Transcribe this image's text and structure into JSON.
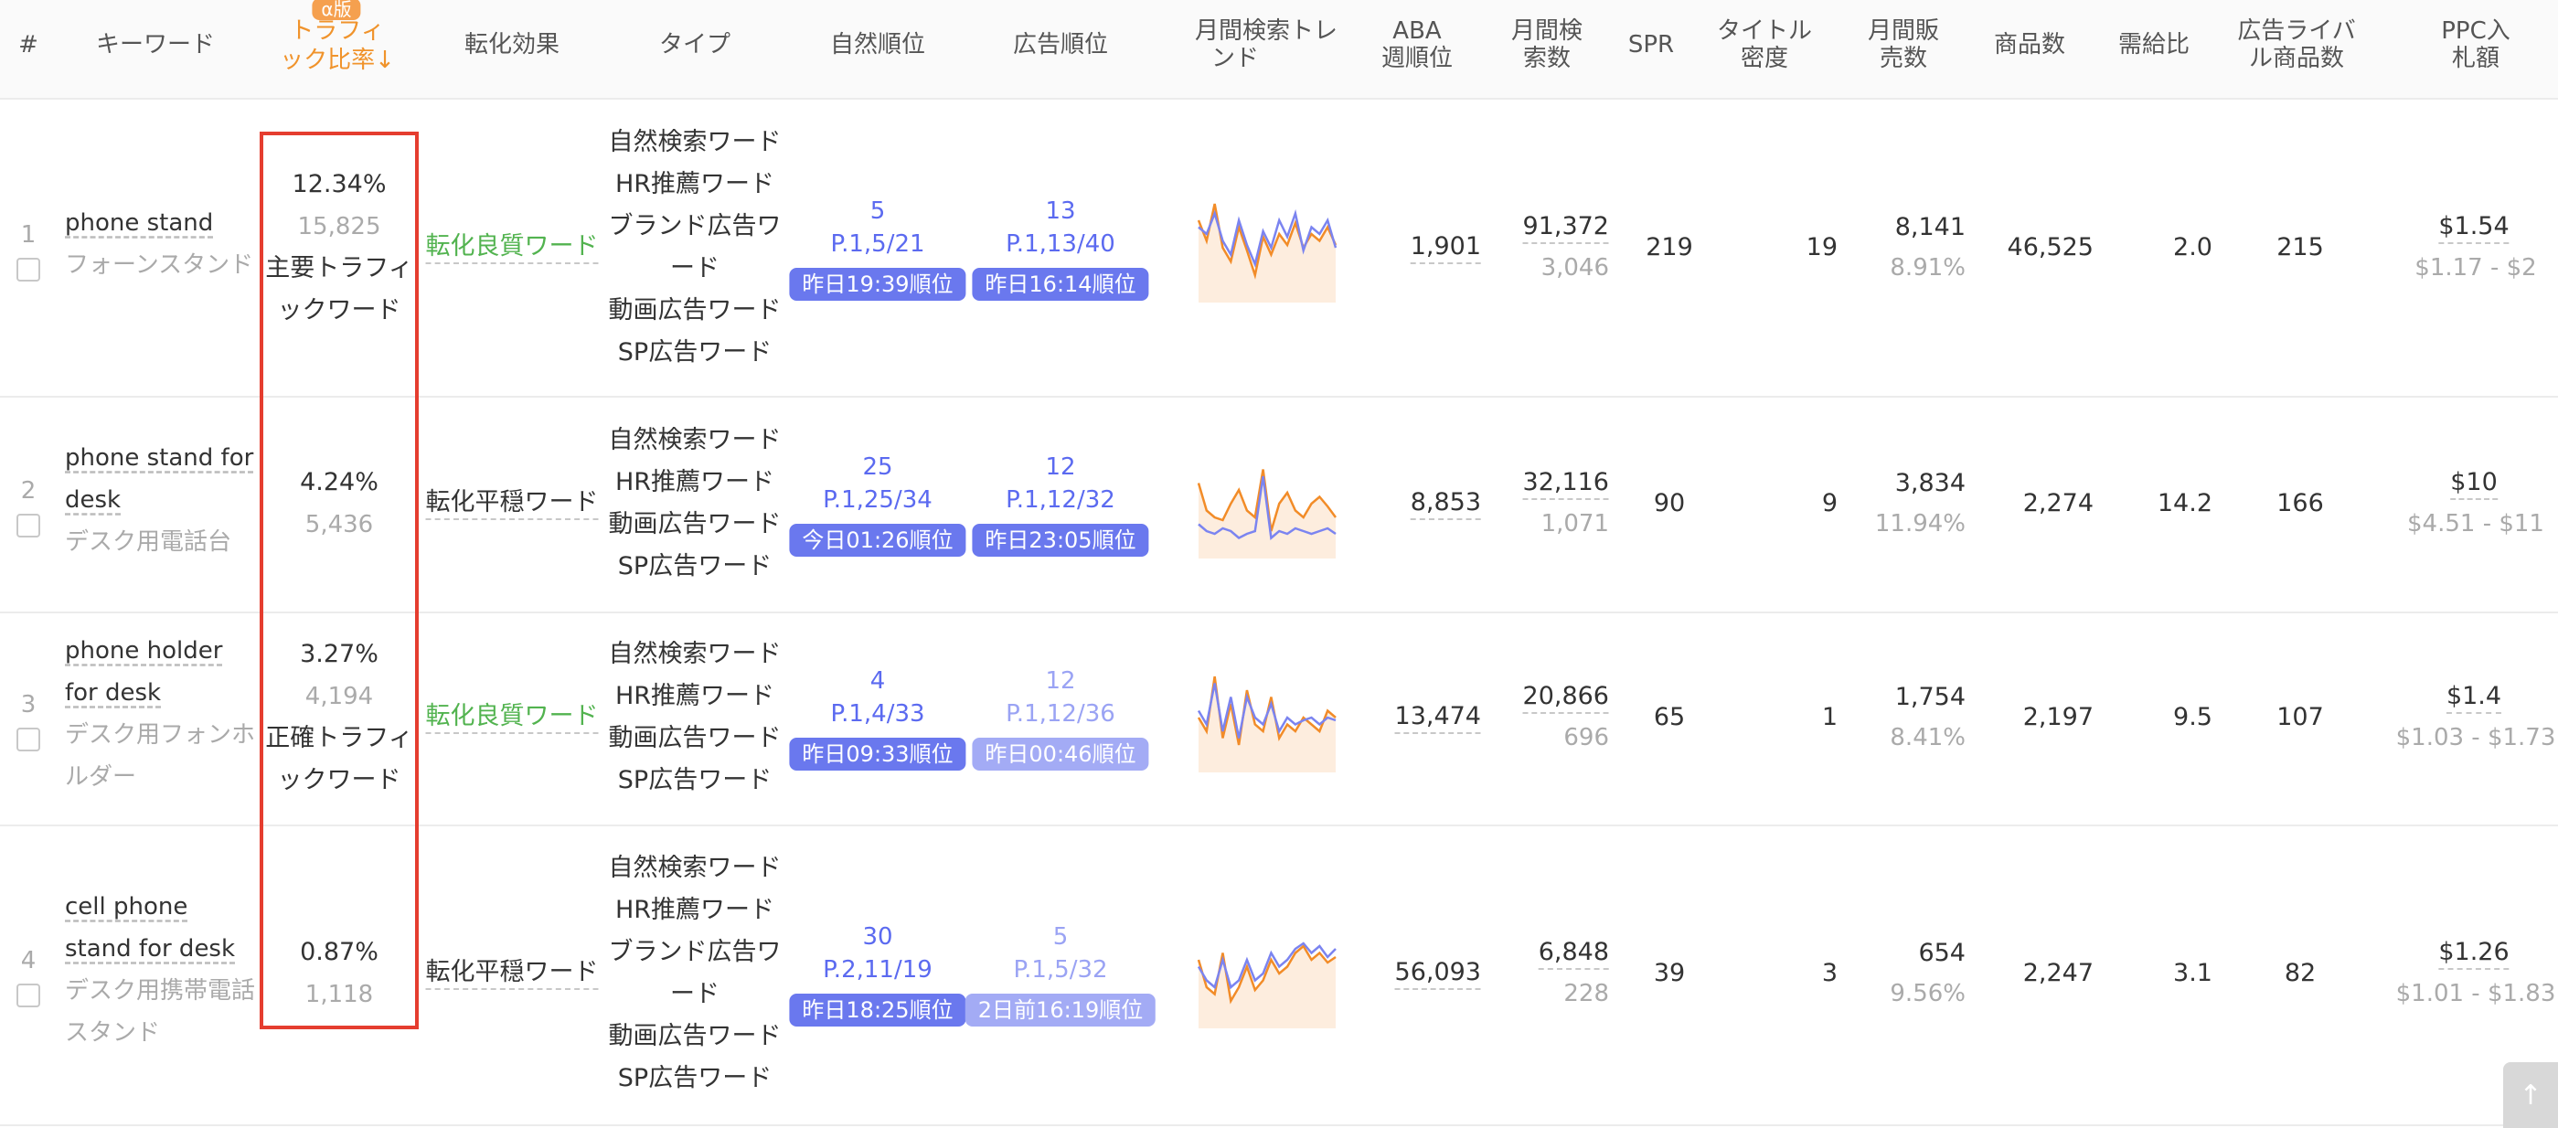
{
  "header": {
    "num": "#",
    "keyword": "キーワード",
    "alpha_badge": "α版",
    "traffic1": "トラフィ",
    "traffic2": "ック比率↓",
    "conversion": "転化効果",
    "type": "タイプ",
    "natural_rank": "自然順位",
    "ad_rank": "広告順位",
    "trend1": "月間検索トレ",
    "trend2": "ンド",
    "aba1": "ABA",
    "aba2": "週順位",
    "monthly1": "月間検",
    "monthly2": "索数",
    "spr": "SPR",
    "title_density1": "タイトル",
    "title_density2": "密度",
    "sales1": "月間販",
    "sales2": "売数",
    "products": "商品数",
    "supply": "需給比",
    "ad_rival1": "広告ライバ",
    "ad_rival2": "ル商品数",
    "ppc1": "PPC入",
    "ppc2": "札額"
  },
  "rows": [
    {
      "index": "1",
      "keyword_lines": [
        "phone stand"
      ],
      "translation_lines": [
        "フォーンスタンド"
      ],
      "traffic_ratio": "12.34%",
      "traffic_count": "15,825",
      "traffic_tag_lines": [
        "主要トラフィ",
        "ックワード"
      ],
      "conversion": "転化良質ワード",
      "types": [
        "自然検索ワード",
        "HR推薦ワード",
        "ブランド広告ワ",
        "ード",
        "動画広告ワード",
        "SP広告ワード"
      ],
      "natural_rank": "5",
      "natural_page": "P.1,5/21",
      "natural_time": "昨日19:39順位",
      "ad_rank": "13",
      "ad_page": "P.1,13/40",
      "ad_time": "昨日16:14順位",
      "aba": "1,901",
      "monthly_search": "91,372",
      "monthly_sub": "3,046",
      "spr": "219",
      "title_density": "19",
      "monthly_sales": "8,141",
      "sales_pct": "8.91%",
      "products": "46,525",
      "supply_ratio": "2.0",
      "ad_rivals": "215",
      "ppc": "$1.54",
      "ppc_range": "$1.17 - $2",
      "trend_orange": [
        60,
        45,
        72,
        40,
        30,
        55,
        38,
        20,
        48,
        35,
        50,
        42,
        58,
        40,
        50,
        45,
        55,
        42
      ],
      "trend_blue": [
        55,
        50,
        65,
        45,
        35,
        60,
        42,
        28,
        52,
        40,
        60,
        48,
        65,
        38,
        55,
        50,
        60,
        40
      ]
    },
    {
      "index": "2",
      "keyword_lines": [
        "phone stand for",
        "desk"
      ],
      "translation_lines": [
        "デスク用電話台"
      ],
      "traffic_ratio": "4.24%",
      "traffic_count": "5,436",
      "traffic_tag_lines": [],
      "conversion": "転化平穏ワード",
      "types": [
        "自然検索ワード",
        "HR推薦ワード",
        "動画広告ワード",
        "SP広告ワード"
      ],
      "natural_rank": "25",
      "natural_page": "P.1,25/34",
      "natural_time": "今日01:26順位",
      "ad_rank": "12",
      "ad_page": "P.1,12/32",
      "ad_time": "昨日23:05順位",
      "aba": "8,853",
      "monthly_search": "32,116",
      "monthly_sub": "1,071",
      "spr": "90",
      "title_density": "9",
      "monthly_sales": "3,834",
      "sales_pct": "11.94%",
      "products": "2,274",
      "supply_ratio": "14.2",
      "ad_rivals": "166",
      "ppc": "$10",
      "ppc_range": "$4.51 - $11",
      "trend_orange": [
        55,
        35,
        30,
        28,
        40,
        50,
        35,
        30,
        65,
        20,
        40,
        48,
        35,
        30,
        40,
        45,
        38,
        30
      ],
      "trend_blue": [
        25,
        20,
        18,
        22,
        20,
        15,
        18,
        20,
        60,
        15,
        20,
        18,
        22,
        20,
        18,
        20,
        22,
        18
      ]
    },
    {
      "index": "3",
      "keyword_lines": [
        "phone holder",
        "for desk"
      ],
      "translation_lines": [
        "デスク用フォンホ",
        "ルダー"
      ],
      "traffic_ratio": "3.27%",
      "traffic_count": "4,194",
      "traffic_tag_lines": [
        "正確トラフィ",
        "ックワード"
      ],
      "conversion": "転化良質ワード",
      "types": [
        "自然検索ワード",
        "HR推薦ワード",
        "動画広告ワード",
        "SP広告ワード"
      ],
      "natural_rank": "4",
      "natural_page": "P.1,4/33",
      "natural_time": "昨日09:33順位",
      "ad_rank": "12",
      "ad_page": "P.1,12/36",
      "ad_time": "昨日00:46順位",
      "aba": "13,474",
      "monthly_search": "20,866",
      "monthly_sub": "696",
      "spr": "65",
      "title_density": "1",
      "monthly_sales": "1,754",
      "sales_pct": "8.41%",
      "products": "2,197",
      "supply_ratio": "9.5",
      "ad_rivals": "107",
      "ppc": "$1.4",
      "ppc_range": "$1.03 - $1.73",
      "trend_orange": [
        40,
        30,
        70,
        25,
        50,
        20,
        60,
        35,
        30,
        55,
        25,
        35,
        30,
        40,
        35,
        30,
        45,
        40
      ],
      "trend_blue": [
        45,
        35,
        65,
        30,
        55,
        25,
        55,
        40,
        35,
        50,
        30,
        40,
        35,
        38,
        40,
        35,
        40,
        38
      ]
    },
    {
      "index": "4",
      "keyword_lines": [
        "cell phone",
        "stand for desk"
      ],
      "translation_lines": [
        "デスク用携帯電話",
        "スタンド"
      ],
      "traffic_ratio": "0.87%",
      "traffic_count": "1,118",
      "traffic_tag_lines": [],
      "conversion": "転化平穏ワード",
      "types": [
        "自然検索ワード",
        "HR推薦ワード",
        "ブランド広告ワ",
        "ード",
        "動画広告ワード",
        "SP広告ワード"
      ],
      "natural_rank": "30",
      "natural_page": "P.2,11/19",
      "natural_time": "昨日18:25順位",
      "ad_rank": "5",
      "ad_page": "P.1,5/32",
      "ad_time": "2日前16:19順位",
      "aba": "56,093",
      "monthly_search": "6,848",
      "monthly_sub": "228",
      "spr": "39",
      "title_density": "3",
      "monthly_sales": "654",
      "sales_pct": "9.56%",
      "products": "2,247",
      "supply_ratio": "3.1",
      "ad_rivals": "82",
      "ppc": "$1.26",
      "ppc_range": "$1.01 - $1.83",
      "trend_orange": [
        50,
        30,
        25,
        55,
        20,
        30,
        45,
        28,
        35,
        50,
        40,
        45,
        55,
        60,
        50,
        55,
        48,
        52
      ],
      "trend_blue": [
        45,
        35,
        30,
        50,
        30,
        35,
        50,
        35,
        40,
        55,
        45,
        50,
        58,
        62,
        55,
        60,
        52,
        58
      ]
    }
  ],
  "colors": {
    "red_highlight": "#e53d2f",
    "orange_header": "#f0932b",
    "blue_rank": "#5b6af0",
    "green_good": "#52b34f",
    "pill_strong": "#6a78ee",
    "pill_light": "#a3abf5",
    "trend_orange": "#f28c28",
    "trend_blue": "#7b84f0"
  },
  "icons": {
    "back_to_top": "arrow-up-icon"
  }
}
